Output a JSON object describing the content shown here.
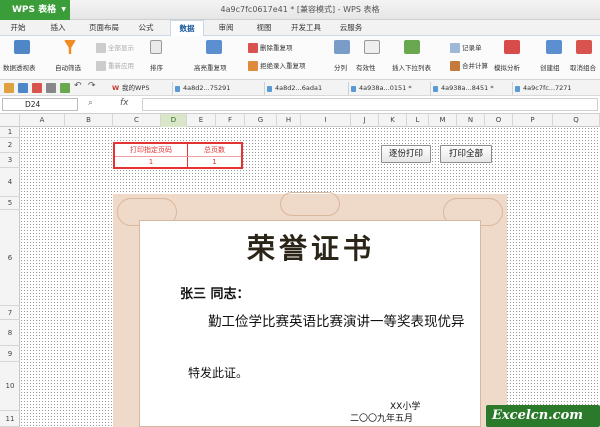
{
  "app": {
    "name": "WPS 表格",
    "window_title": "4a9c7fc0617e41 * [兼容模式] - WPS 表格"
  },
  "menu": [
    "开始",
    "插入",
    "页面布局",
    "公式",
    "数据",
    "审阅",
    "视图",
    "开发工具",
    "云服务"
  ],
  "menu_active": "数据",
  "ribbon": {
    "pivot": "数据透视表",
    "autofilter": "自动筛选",
    "showall": "全部显示",
    "reapply": "重新应用",
    "sort": "排序",
    "highlight_dup": "高亮重复项",
    "remove_dup": "删除重复项",
    "reject_dup": "拒绝录入重复项",
    "split": "分列",
    "validity": "有效性",
    "insert_dropdown": "插入下拉列表",
    "record": "记录单",
    "merge_calc": "合并计算",
    "simulate": "模拟分析",
    "create_group": "创建组",
    "ungroup": "取消组合"
  },
  "doc_tabs": [
    "我的WPS",
    "4a8d2...75291",
    "4a8d2...6ada1",
    "4a938a...0151 *",
    "4a938a...8451 *",
    "4a9c7fc...7271"
  ],
  "namebox": "D24",
  "fx": "fx",
  "columns": [
    "A",
    "B",
    "C",
    "D",
    "E",
    "F",
    "G",
    "H",
    "I",
    "J",
    "K",
    "L",
    "M",
    "N",
    "O",
    "P",
    "Q"
  ],
  "rows": [
    "1",
    "2",
    "3",
    "4",
    "5",
    "6",
    "7",
    "8",
    "9",
    "10",
    "11"
  ],
  "print_table": {
    "h1": "打印指定页码",
    "h2": "总页数",
    "v1": "1",
    "v2": "1"
  },
  "buttons": {
    "per_page": "逐份打印",
    "print_all": "打印全部"
  },
  "certificate": {
    "title": "荣誉证书",
    "name": "张三 同志：",
    "body": "勤工俭学比赛英语比赛演讲一等奖表现优异",
    "closing": "特发此证。",
    "school": "XX小学",
    "date": "二〇〇九年五月"
  },
  "watermark": "Excelcn.com",
  "colors": {
    "accent": "#3a9d3a",
    "highlight_border": "#e53333",
    "cert_frame": "#efd9c8"
  }
}
